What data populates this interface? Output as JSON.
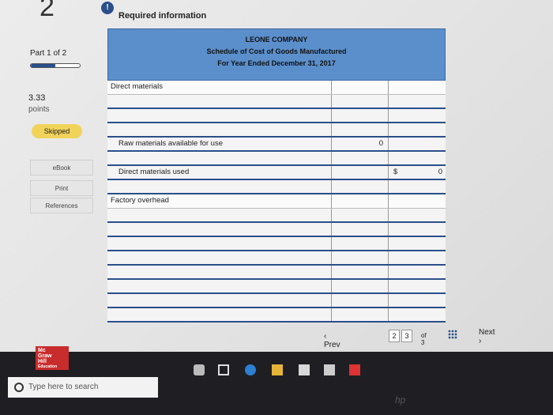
{
  "header": {
    "question_number": "2",
    "info_icon": "!",
    "required_info": "Required information"
  },
  "sidebar": {
    "part": "Part 1 of 2",
    "part_progress": 0.5,
    "points_value": "3.33",
    "points_label": "points",
    "skipped": "Skipped",
    "buttons": [
      "eBook",
      "Print",
      "References"
    ]
  },
  "sheet": {
    "company": "LEONE COMPANY",
    "title": "Schedule of Cost of Goods Manufactured",
    "period": "For Year Ended December 31, 2017",
    "direct_materials_label": "Direct materials",
    "raw_available_label": "Raw materials available for use",
    "raw_available_value": "0",
    "dm_used_label": "Direct materials used",
    "dm_used_dollar": "$",
    "dm_used_value": "0",
    "factory_overhead_label": "Factory overhead"
  },
  "nav": {
    "prev": "‹ Prev",
    "pages": [
      "2",
      "3"
    ],
    "of_total": "of 3",
    "next": "Next ›"
  },
  "taskbar": {
    "logo_lines": [
      "Mc",
      "Graw",
      "Hill",
      "Education"
    ],
    "search_placeholder": "Type here to search",
    "brand": "hp"
  }
}
